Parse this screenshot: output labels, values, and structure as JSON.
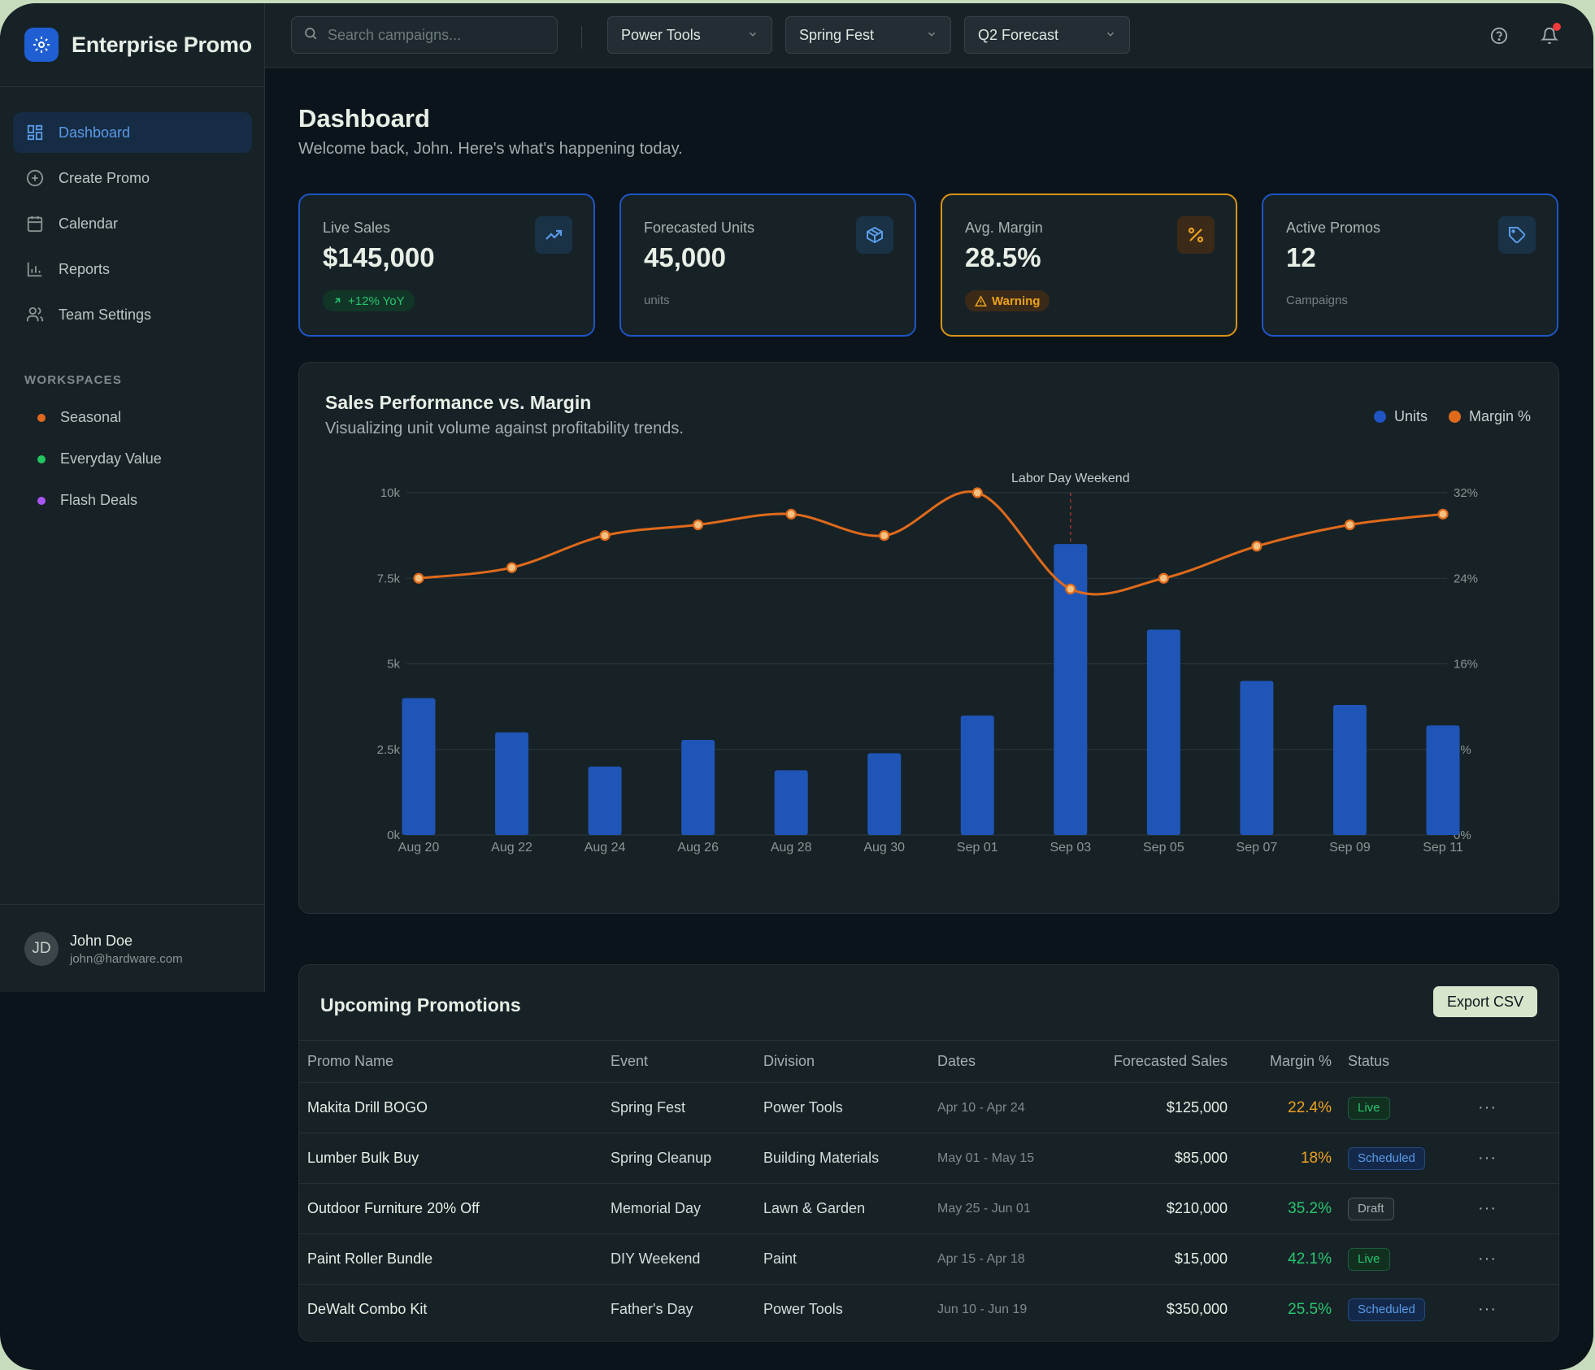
{
  "app": {
    "name": "Enterprise Promo"
  },
  "sidebar": {
    "nav": [
      {
        "label": "Dashboard",
        "icon": "grid-icon",
        "active": true
      },
      {
        "label": "Create Promo",
        "icon": "plus-circle-icon"
      },
      {
        "label": "Calendar",
        "icon": "calendar-icon"
      },
      {
        "label": "Reports",
        "icon": "bar-chart-icon"
      },
      {
        "label": "Team Settings",
        "icon": "users-icon"
      }
    ],
    "workspaces_title": "WORKSPACES",
    "workspaces": [
      {
        "label": "Seasonal",
        "color": "#e06a1b"
      },
      {
        "label": "Everyday Value",
        "color": "#22c55e"
      },
      {
        "label": "Flash Deals",
        "color": "#a855f7"
      }
    ],
    "user": {
      "initials": "JD",
      "name": "John Doe",
      "email": "john@hardware.com"
    }
  },
  "topbar": {
    "search_placeholder": "Search campaigns...",
    "filters": [
      "Power Tools",
      "Spring Fest",
      "Q2 Forecast"
    ]
  },
  "page": {
    "title": "Dashboard",
    "subtitle": "Welcome back, John. Here's what's happening today."
  },
  "kpis": [
    {
      "label": "Live Sales",
      "value": "$145,000",
      "badge": "+12% YoY",
      "icon": "trending-up-icon"
    },
    {
      "label": "Forecasted Units",
      "value": "45,000",
      "sub": "units",
      "icon": "box-icon"
    },
    {
      "label": "Avg. Margin",
      "value": "28.5%",
      "badge": "Warning",
      "icon": "percent-icon"
    },
    {
      "label": "Active Promos",
      "value": "12",
      "sub": "Campaigns",
      "icon": "tag-icon"
    }
  ],
  "chart": {
    "title": "Sales Performance vs. Margin",
    "subtitle": "Visualizing unit volume against profitability trends.",
    "legend": [
      "Units",
      "Margin %"
    ]
  },
  "chart_data": {
    "type": "bar",
    "categories": [
      "Aug 20",
      "Aug 22",
      "Aug 24",
      "Aug 26",
      "Aug 28",
      "Aug 30",
      "Sep 01",
      "Sep 03",
      "Sep 05",
      "Sep 07",
      "Sep 09",
      "Sep 11"
    ],
    "series": [
      {
        "name": "Units",
        "type": "bar",
        "axis": "left",
        "color": "#1f55b6",
        "values": [
          4000,
          3000,
          2000,
          2780,
          1890,
          2390,
          3490,
          8500,
          6000,
          4500,
          3800,
          3200
        ]
      },
      {
        "name": "Margin %",
        "type": "line",
        "axis": "right",
        "color": "#e06a1b",
        "values": [
          24,
          25,
          28,
          29,
          30,
          28,
          32,
          23,
          24,
          27,
          29,
          30
        ]
      }
    ],
    "y_left": {
      "ticks": [
        "0k",
        "2.5k",
        "5k",
        "7.5k",
        "10k"
      ],
      "range": [
        0,
        10000
      ]
    },
    "y_right": {
      "ticks": [
        "0%",
        "8%",
        "16%",
        "24%",
        "32%"
      ],
      "range": [
        0,
        32
      ]
    },
    "annotation": {
      "category": "Sep 03",
      "label": "Labor Day Weekend"
    },
    "grid": true,
    "legend_position": "top-right"
  },
  "table": {
    "title": "Upcoming Promotions",
    "export_label": "Export CSV",
    "headers": [
      "Promo Name",
      "Event",
      "Division",
      "Dates",
      "Forecasted Sales",
      "Margin %",
      "Status"
    ],
    "rows": [
      {
        "name": "Makita Drill BOGO",
        "event": "Spring Fest",
        "division": "Power Tools",
        "dates": "Apr 10 - Apr 24",
        "sales": "$125,000",
        "margin": "22.4%",
        "margin_color": "#eda21e",
        "status": "Live",
        "status_kind": "live"
      },
      {
        "name": "Lumber Bulk Buy",
        "event": "Spring Cleanup",
        "division": "Building Materials",
        "dates": "May 01 - May 15",
        "sales": "$85,000",
        "margin": "18%",
        "margin_color": "#eda21e",
        "status": "Scheduled",
        "status_kind": "scheduled"
      },
      {
        "name": "Outdoor Furniture 20% Off",
        "event": "Memorial Day",
        "division": "Lawn & Garden",
        "dates": "May 25 - Jun 01",
        "sales": "$210,000",
        "margin": "35.2%",
        "margin_color": "#29c56f",
        "status": "Draft",
        "status_kind": "draft"
      },
      {
        "name": "Paint Roller Bundle",
        "event": "DIY Weekend",
        "division": "Paint",
        "dates": "Apr 15 - Apr 18",
        "sales": "$15,000",
        "margin": "42.1%",
        "margin_color": "#29c56f",
        "status": "Live",
        "status_kind": "live"
      },
      {
        "name": "DeWalt Combo Kit",
        "event": "Father's Day",
        "division": "Power Tools",
        "dates": "Jun 10 - Jun 19",
        "sales": "$350,000",
        "margin": "25.5%",
        "margin_color": "#29c56f",
        "status": "Scheduled",
        "status_kind": "scheduled"
      }
    ],
    "more_label": "···"
  }
}
